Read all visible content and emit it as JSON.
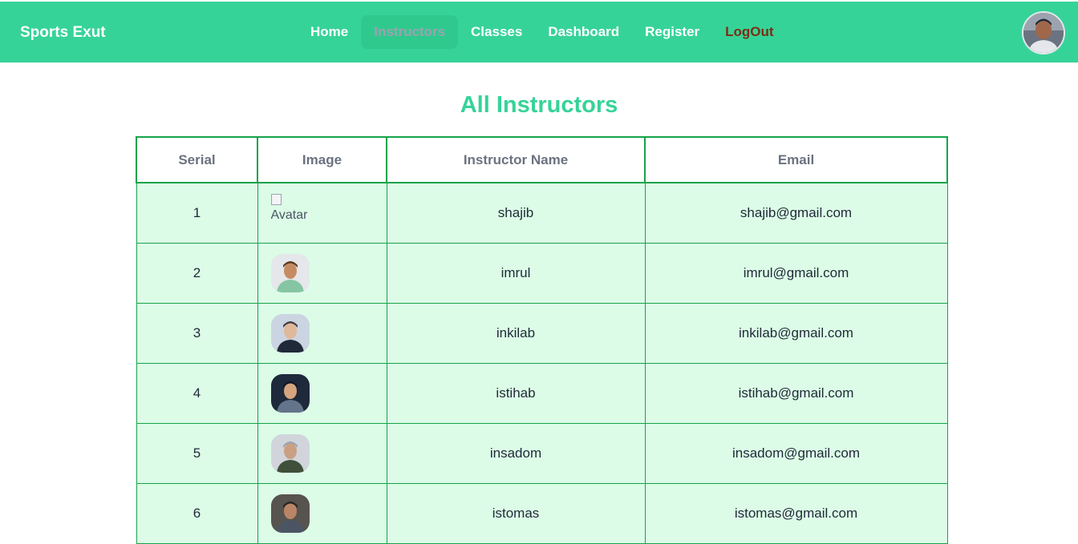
{
  "header": {
    "brand": "Sports Exut",
    "nav": [
      {
        "label": "Home",
        "key": "home",
        "active": false
      },
      {
        "label": "Instructors",
        "key": "instructors",
        "active": true
      },
      {
        "label": "Classes",
        "key": "classes",
        "active": false
      },
      {
        "label": "Dashboard",
        "key": "dashboard",
        "active": false
      },
      {
        "label": "Register",
        "key": "register",
        "active": false
      },
      {
        "label": "LogOut",
        "key": "logout",
        "active": false
      }
    ],
    "user_avatar": "user-avatar-icon"
  },
  "main": {
    "title": "All Instructors",
    "table": {
      "headers": [
        "Serial",
        "Image",
        "Instructor Name",
        "Email"
      ],
      "rows": [
        {
          "serial": "1",
          "image_alt": "Avatar",
          "image_broken": true,
          "name": "shajib",
          "email": "shajib@gmail.com"
        },
        {
          "serial": "2",
          "image_broken": false,
          "name": "imrul",
          "email": "imrul@gmail.com"
        },
        {
          "serial": "3",
          "image_broken": false,
          "name": "inkilab",
          "email": "inkilab@gmail.com"
        },
        {
          "serial": "4",
          "image_broken": false,
          "name": "istihab",
          "email": "istihab@gmail.com"
        },
        {
          "serial": "5",
          "image_broken": false,
          "name": "insadom",
          "email": "insadom@gmail.com"
        },
        {
          "serial": "6",
          "image_broken": false,
          "name": "istomas",
          "email": "istomas@gmail.com"
        }
      ]
    }
  },
  "colors": {
    "primary": "#36d399",
    "row_background": "#dcfce7",
    "table_border": "#16a34a",
    "logout_text": "#7c2d12"
  }
}
